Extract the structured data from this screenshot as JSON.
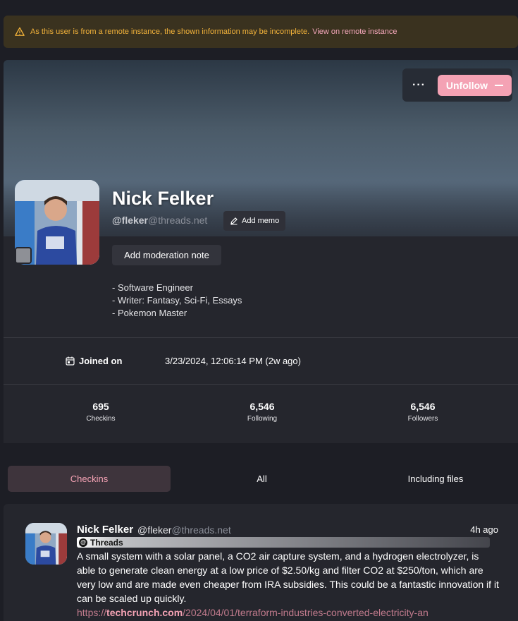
{
  "warning": {
    "text": "As this user is from a remote instance, the shown information may be incomplete.",
    "link": "View on remote instance"
  },
  "profile": {
    "unfollow_label": "Unfollow",
    "name": "Nick Felker",
    "handle_user": "@fleker",
    "handle_host": "@threads.net",
    "add_memo": "Add memo",
    "add_moderation_note": "Add moderation note",
    "bio": [
      "- Software Engineer",
      "- Writer: Fantasy, Sci-Fi, Essays",
      "- Pokemon Master"
    ],
    "joined_label": "Joined on",
    "joined_value": "3/23/2024, 12:06:14 PM (2w ago)",
    "stats": [
      {
        "value": "695",
        "label": "Checkins"
      },
      {
        "value": "6,546",
        "label": "Following"
      },
      {
        "value": "6,546",
        "label": "Followers"
      }
    ]
  },
  "tabs": [
    {
      "label": "Checkins",
      "active": true
    },
    {
      "label": "All",
      "active": false
    },
    {
      "label": "Including files",
      "active": false
    }
  ],
  "note": {
    "name": "Nick Felker",
    "handle_user": "@fleker",
    "handle_host": "@threads.net",
    "time": "4h ago",
    "instance": "Threads",
    "text": "A small system with a solar panel, a CO2 air capture system, and a hydrogen electrolyzer, is able to generate clean energy at a low price of $2.50/kg and filter CO2 at $250/ton, which are very low and are made even cheaper from IRA subsidies. This could be a fantastic innovation if it can be scaled up quickly.",
    "link_prefix": "https://",
    "link_host": "techcrunch.com",
    "link_path": "/2024/04/01/terraform-industries-converted-electricity-an"
  },
  "colors": {
    "accent": "#f4a2b4",
    "warning": "#f2b23a",
    "background": "#1d1e25",
    "panel": "#25262d"
  },
  "icons": [
    "warning-icon",
    "more-icon",
    "minus-icon",
    "pencil-icon",
    "calendar-icon",
    "threads-icon"
  ]
}
